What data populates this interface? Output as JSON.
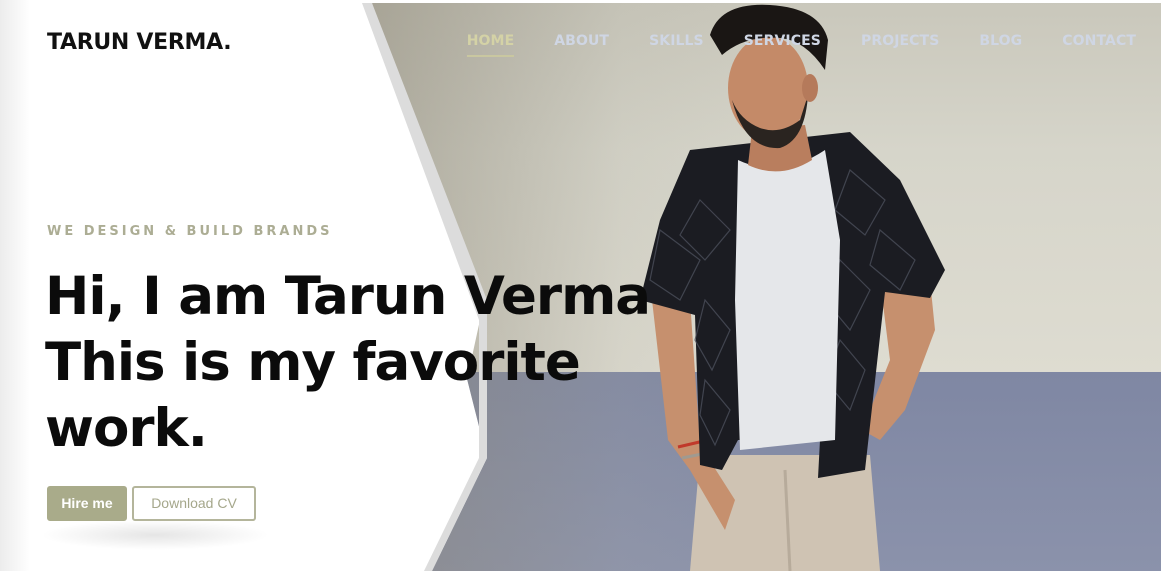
{
  "brand": {
    "name": "TARUN VERMA."
  },
  "nav": {
    "items": [
      {
        "label": "HOME",
        "active": true
      },
      {
        "label": "ABOUT",
        "active": false
      },
      {
        "label": "SKILLS",
        "active": false
      },
      {
        "label": "SERVICES",
        "active": false
      },
      {
        "label": "PROJECTS",
        "active": false
      },
      {
        "label": "BLOG",
        "active": false
      },
      {
        "label": "CONTACT",
        "active": false
      }
    ]
  },
  "hero": {
    "tagline": "WE DESIGN & BUILD BRANDS",
    "headline_lines": [
      "Hi, I am Tarun Verma",
      "This is my favorite",
      "work."
    ],
    "buttons": {
      "hire": "Hire me",
      "download": "Download CV"
    }
  },
  "colors": {
    "accent": "#a9ab8a",
    "nav_active": "#d4d2a6",
    "nav_text": "#cfd6e4",
    "headline": "#0b0b0b"
  }
}
